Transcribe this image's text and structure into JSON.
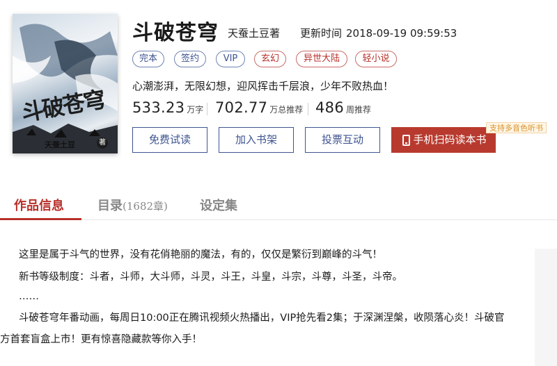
{
  "book": {
    "title": "斗破苍穹",
    "author": "天蚕土豆著",
    "update_label": "更新时间",
    "update_time": "2018-09-19 09:59:53",
    "slogan": "心潮澎湃，无限幻想，迎风挥击千层浪，少年不败热血！"
  },
  "cover": {
    "title": "斗破苍穹",
    "author": "天蚕土豆",
    "seal": "著"
  },
  "tags": [
    {
      "label": "完本",
      "style": "blue"
    },
    {
      "label": "签约",
      "style": "blue"
    },
    {
      "label": "VIP",
      "style": "blue"
    },
    {
      "label": "玄幻",
      "style": "red"
    },
    {
      "label": "异世大陆",
      "style": "red"
    },
    {
      "label": "轻小说",
      "style": "red"
    }
  ],
  "stats": [
    {
      "value": "533.23",
      "unit": "万字"
    },
    {
      "value": "702.77",
      "unit": "万总推荐"
    },
    {
      "value": "486",
      "unit": "周推荐"
    }
  ],
  "buttons": {
    "free_read": "免费试读",
    "add_shelf": "加入书架",
    "vote": "投票互动",
    "phone_read": "手机扫码读本书",
    "audio_badge": "支持多音色听书"
  },
  "tabs": [
    {
      "label": "作品信息",
      "count": ""
    },
    {
      "label": "目录",
      "count": "(1682章)"
    },
    {
      "label": "设定集",
      "count": ""
    }
  ],
  "description": [
    "这里是属于斗气的世界，没有花俏艳丽的魔法，有的，仅仅是繁衍到巅峰的斗气！",
    "新书等级制度：斗者，斗师，大斗师，斗灵，斗王，斗皇，斗宗，斗尊，斗圣，斗帝。",
    "……",
    "斗破苍穹年番动画，每周日10:00正在腾讯视频火热播出，VIP抢先看2集；于深渊涅槃，收陨落心炎！斗破官",
    "方首套盲盒上市！更有惊喜隐藏款等你入手！"
  ],
  "colors": {
    "accent_red": "#b8302a",
    "accent_blue": "#3e5490",
    "badge_orange": "#d8912a"
  }
}
